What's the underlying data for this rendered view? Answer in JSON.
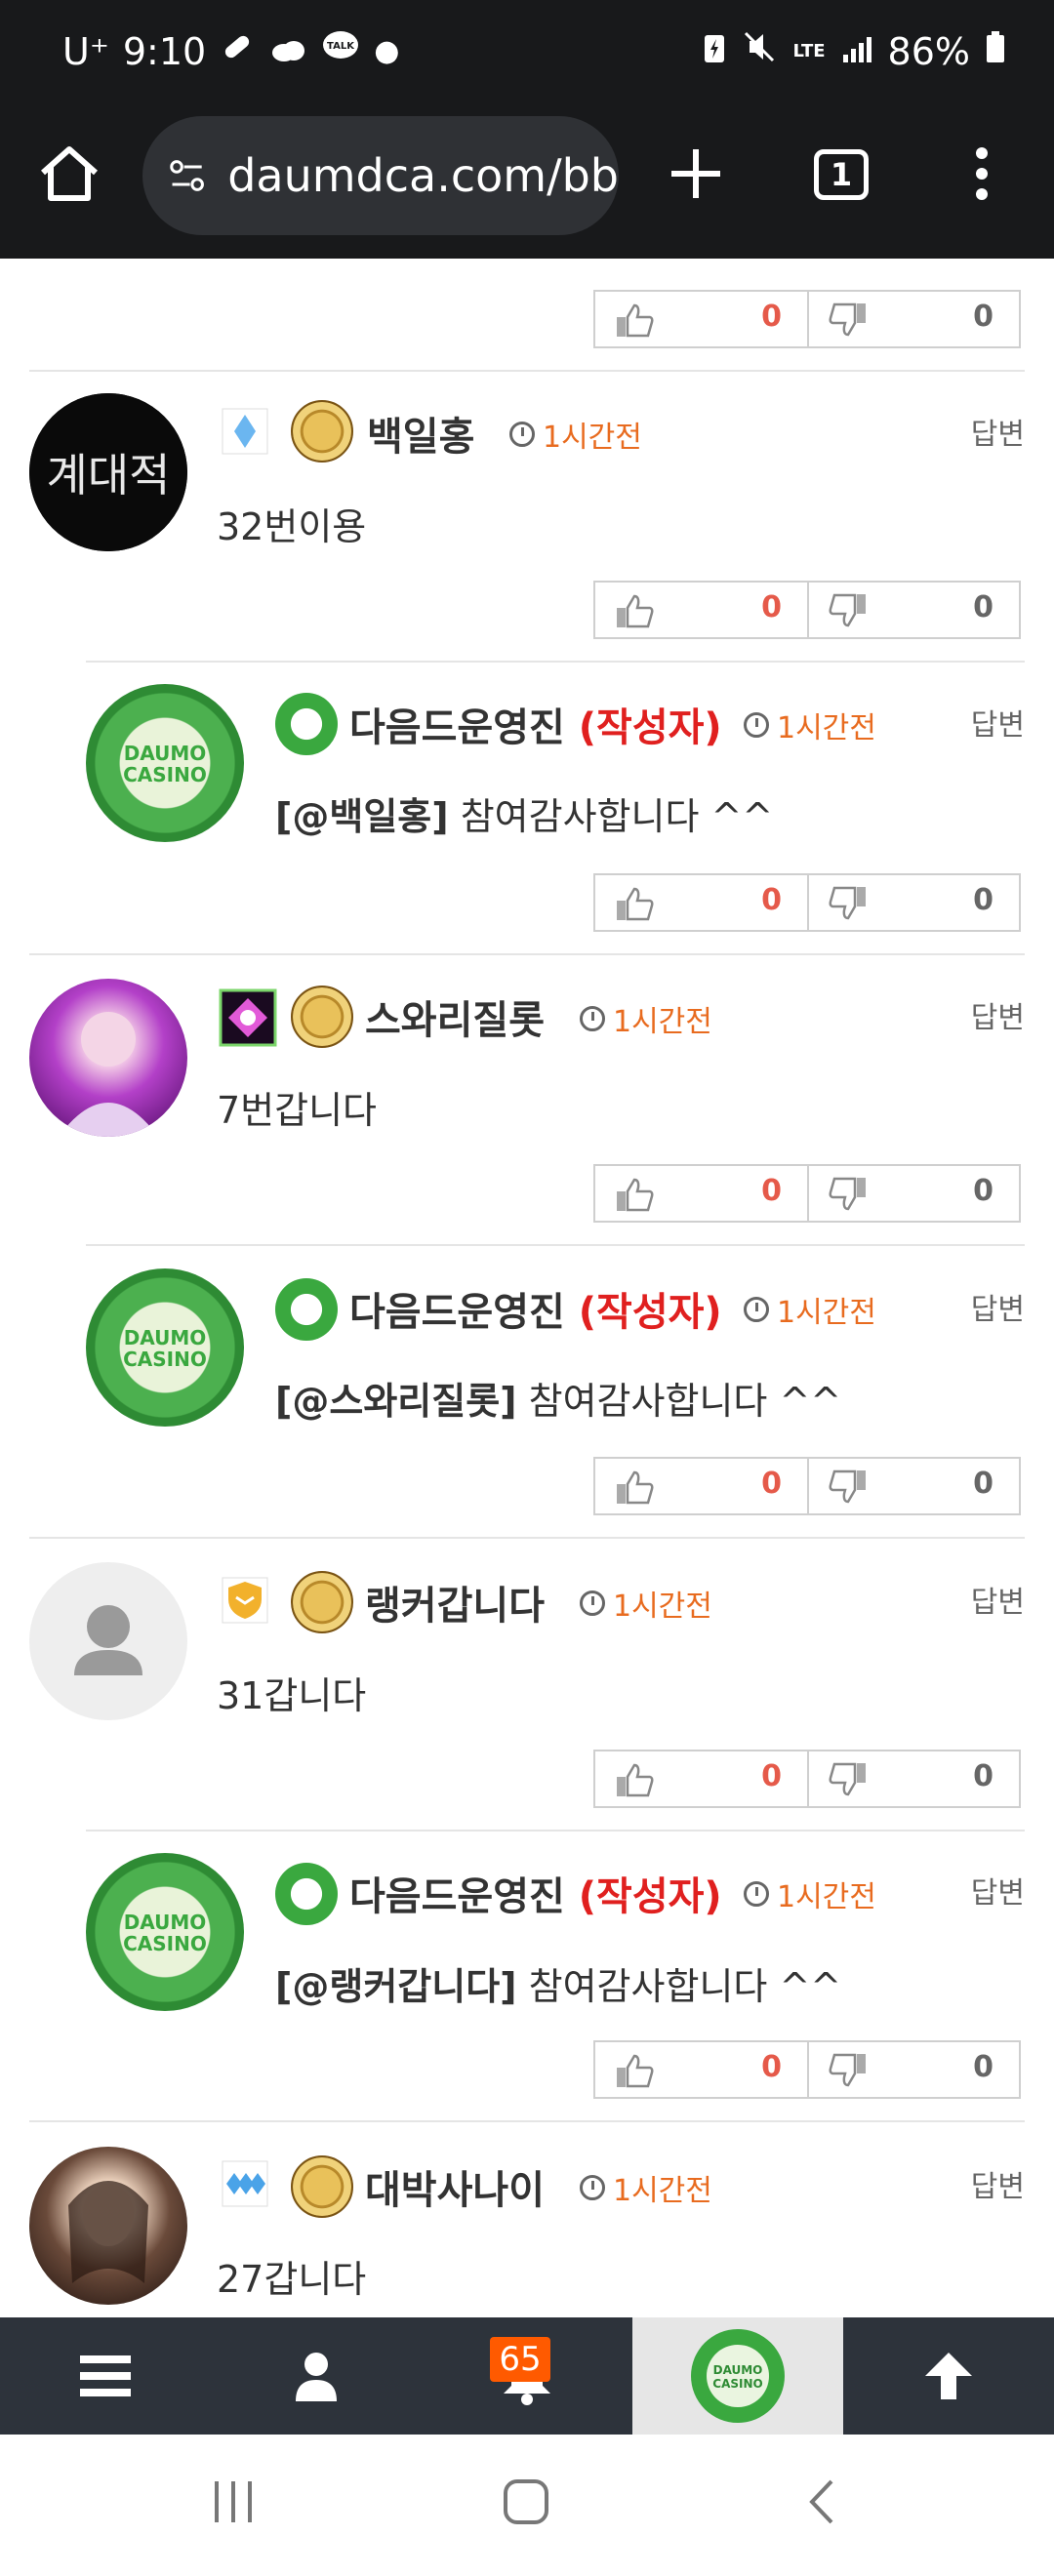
{
  "status": {
    "carrier": "U⁺",
    "time": "9:10",
    "network": "LTE",
    "battery": "86%"
  },
  "browser": {
    "url": "daumdca.com/bb",
    "tab_count": "1"
  },
  "votes": {
    "up": "0",
    "down": "0"
  },
  "comments": [
    {
      "username": "백일홍",
      "time": "1시간전",
      "reply": "답변",
      "text": "32번이용"
    },
    {
      "username": "다음드운영진",
      "author_tag": "(작성자)",
      "time": "1시간전",
      "reply": "답변",
      "mention": "[@백일홍]",
      "text": "참여감사합니다 ^^"
    },
    {
      "username": "스와리질롯",
      "time": "1시간전",
      "reply": "답변",
      "text": "7번갑니다"
    },
    {
      "username": "다음드운영진",
      "author_tag": "(작성자)",
      "time": "1시간전",
      "reply": "답변",
      "mention": "[@스와리질롯]",
      "text": "참여감사합니다 ^^"
    },
    {
      "username": "랭커갑니다",
      "time": "1시간전",
      "reply": "답변",
      "text": "31갑니다"
    },
    {
      "username": "다음드운영진",
      "author_tag": "(작성자)",
      "time": "1시간전",
      "reply": "답변",
      "mention": "[@랭커갑니다]",
      "text": "참여감사합니다 ^^"
    },
    {
      "username": "대박사나이",
      "time": "1시간전",
      "reply": "답변",
      "text": "27갑니다"
    }
  ],
  "bottomnav": {
    "notifications": "65",
    "logo_text": "DAUMO CASINO"
  },
  "colors": {
    "accent": "#e86b1f",
    "author": "#e0201f",
    "up": "#e55a4a",
    "brand_green": "#3aa83f"
  }
}
